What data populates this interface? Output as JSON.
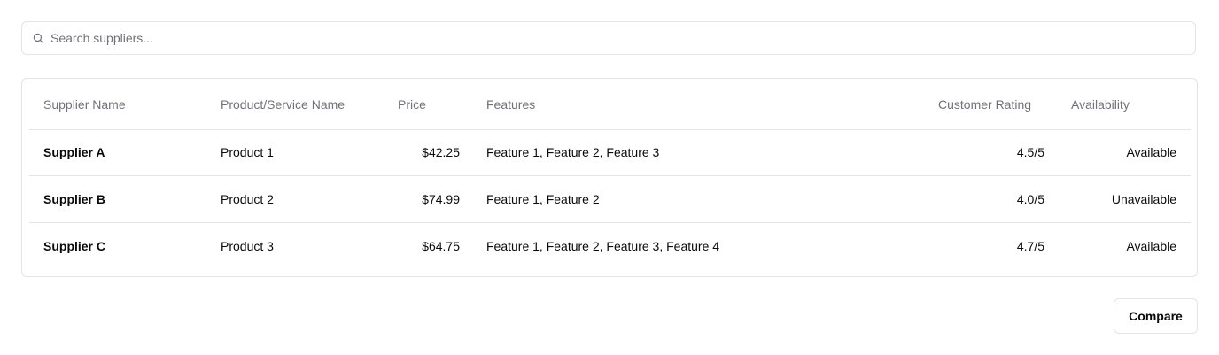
{
  "search": {
    "placeholder": "Search suppliers...",
    "value": "",
    "icon": "search-icon"
  },
  "table": {
    "headers": [
      "Supplier Name",
      "Product/Service Name",
      "Price",
      "Features",
      "Customer Rating",
      "Availability"
    ],
    "rows": [
      {
        "supplier": "Supplier A",
        "product": "Product 1",
        "price": "$42.25",
        "features": "Feature 1, Feature 2, Feature 3",
        "rating": "4.5/5",
        "availability": "Available"
      },
      {
        "supplier": "Supplier B",
        "product": "Product 2",
        "price": "$74.99",
        "features": "Feature 1, Feature 2",
        "rating": "4.0/5",
        "availability": "Unavailable"
      },
      {
        "supplier": "Supplier C",
        "product": "Product 3",
        "price": "$64.75",
        "features": "Feature 1, Feature 2, Feature 3, Feature 4",
        "rating": "4.7/5",
        "availability": "Available"
      }
    ]
  },
  "actions": {
    "compare_label": "Compare"
  },
  "colors": {
    "border": "#e4e4e7",
    "muted_text": "#71717a",
    "text": "#0a0a0a"
  }
}
